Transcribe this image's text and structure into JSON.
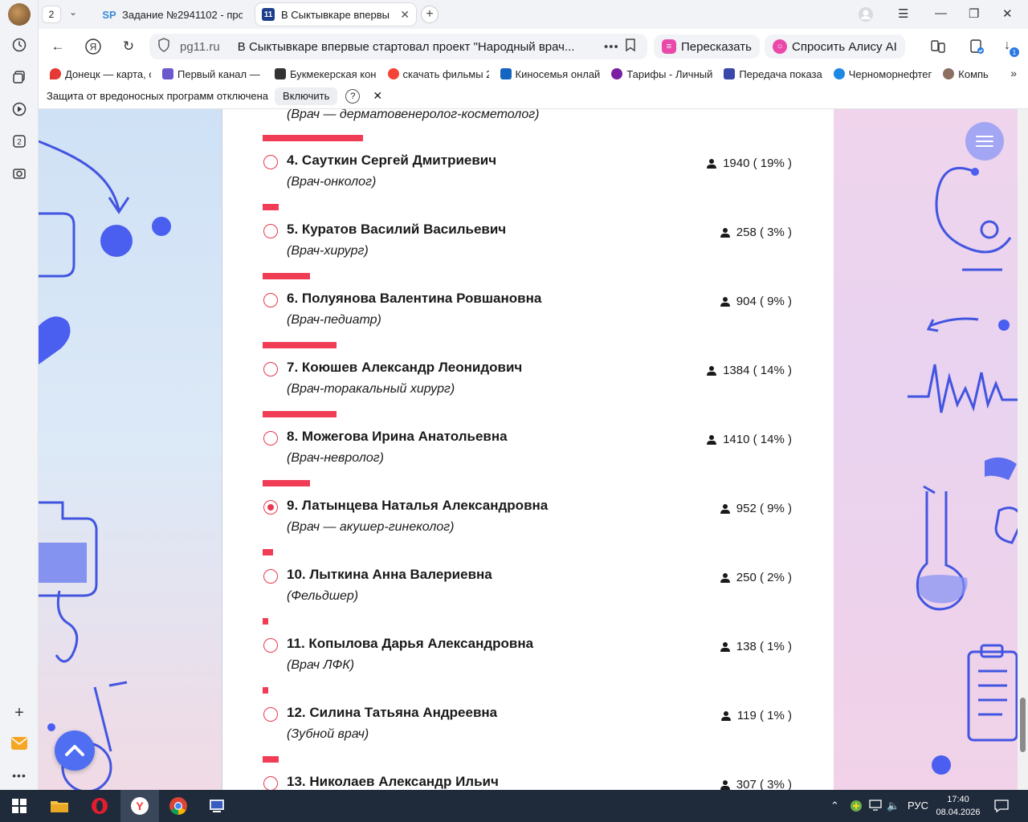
{
  "browser": {
    "tab_count": "2",
    "tabs": [
      {
        "favicon": "SP",
        "title": "Задание №2941102 - про"
      },
      {
        "favicon": "11",
        "title": "В Сыктывкаре впервы"
      }
    ],
    "address": {
      "host": "pg11.ru",
      "page_title": "В Сыктывкаре впервые стартовал проект \"Народный врач..."
    },
    "retell_label": "Пересказать",
    "alice_label": "Спросить Алису AI",
    "downloads_badge": "1",
    "bookmarks": [
      {
        "label": "Донецк — карта, с",
        "color": "#e53935"
      },
      {
        "label": "Первый канал — с",
        "color": "#6a5acd"
      },
      {
        "label": "Букмекерская кон",
        "color": "#333333"
      },
      {
        "label": "скачать фильмы 2",
        "color": "#f44336"
      },
      {
        "label": "Киносемья онлай",
        "color": "#1565c0"
      },
      {
        "label": "Тарифы - Личный",
        "color": "#7b1fa2"
      },
      {
        "label": "Передача показа",
        "color": "#3949ab"
      },
      {
        "label": "Черноморнефтег",
        "color": "#1e88e5"
      },
      {
        "label": "Компь",
        "color": "#8d6e63"
      }
    ],
    "infobar": {
      "message": "Защита от вредоносных программ отключена",
      "button": "Включить",
      "help": "?",
      "close": "✕"
    }
  },
  "poll": {
    "top_partial_role": "(Врач — дерматовенеролог-косметолог)",
    "candidates": [
      {
        "name": "4. Сауткин Сергей Дмитриевич",
        "role": "(Врач-онколог)",
        "votes": "1940",
        "percent": "19%",
        "share": 0.19,
        "selected": false
      },
      {
        "name": "5. Куратов Василий Васильевич",
        "role": "(Врач-хирург)",
        "votes": "258",
        "percent": "3%",
        "share": 0.03,
        "selected": false
      },
      {
        "name": "6. Полуянова Валентина Ровшановна",
        "role": "(Врач-педиатр)",
        "votes": "904",
        "percent": "9%",
        "share": 0.09,
        "selected": false
      },
      {
        "name": "7. Коюшев Александр Леонидович",
        "role": "(Врач-торакальный хирург)",
        "votes": "1384",
        "percent": "14%",
        "share": 0.14,
        "selected": false
      },
      {
        "name": "8. Можегова Ирина Анатольевна",
        "role": "(Врач-невролог)",
        "votes": "1410",
        "percent": "14%",
        "share": 0.14,
        "selected": false
      },
      {
        "name": "9. Латынцева Наталья Александровна",
        "role": "(Врач — акушер-гинеколог)",
        "votes": "952",
        "percent": "9%",
        "share": 0.09,
        "selected": true
      },
      {
        "name": "10. Лыткина Анна Валериевна",
        "role": "(Фельдшер)",
        "votes": "250",
        "percent": "2%",
        "share": 0.02,
        "selected": false
      },
      {
        "name": "11. Копылова Дарья Александровна",
        "role": "(Врач ЛФК)",
        "votes": "138",
        "percent": "1%",
        "share": 0.01,
        "selected": false
      },
      {
        "name": "12. Силина Татьяна Андреевна",
        "role": "(Зубной врач)",
        "votes": "119",
        "percent": "1%",
        "share": 0.01,
        "selected": false
      },
      {
        "name": "13. Николаев Александр Ильич",
        "role": "",
        "votes": "307",
        "percent": "3%",
        "share": 0.03,
        "selected": false
      }
    ]
  },
  "taskbar": {
    "lang": "РУС",
    "time": "17:40",
    "date": "08.04.2026"
  },
  "colors": {
    "accent": "#f13c55",
    "fab_up": "#4f6ef2",
    "fab_menu": "#a3a6f2"
  }
}
